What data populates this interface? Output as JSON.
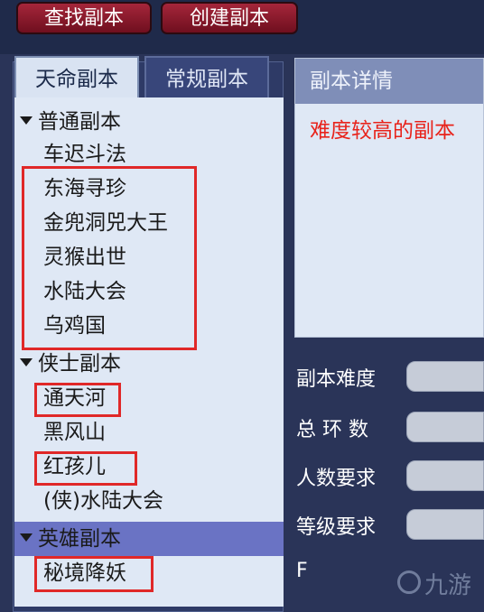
{
  "toolbar": {
    "find_label": "查找副本",
    "create_label": "创建副本"
  },
  "tabs": {
    "active": "天命副本",
    "inactive": "常规副本"
  },
  "list": {
    "categories": {
      "normal": "普通副本",
      "knight": "侠士副本",
      "hero": "英雄副本"
    },
    "items": [
      "车迟斗法",
      "东海寻珍",
      "金兜洞兕大王",
      "灵猴出世",
      "水陆大会",
      "乌鸡国",
      "通天河",
      "黑风山",
      "红孩儿",
      "(侠)水陆大会",
      "秘境降妖"
    ]
  },
  "detail": {
    "header": "副本详情",
    "description": "难度较高的副本"
  },
  "fields": {
    "difficulty": "副本难度",
    "total_rings": "总 环 数",
    "people": "人数要求",
    "level": "等级要求",
    "partial": "F"
  },
  "watermark": "九游",
  "colors": {
    "highlight": "#e02828",
    "accent_text": "#e8231b",
    "selected_category": "#6a73c4"
  }
}
